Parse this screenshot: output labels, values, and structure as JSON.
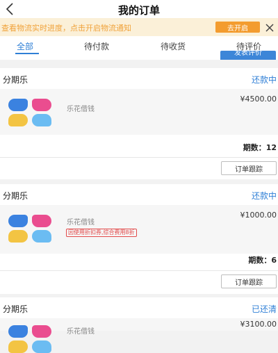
{
  "header": {
    "title": "我的订单"
  },
  "notice": {
    "text": "查看物流实时进度，点击开启物流通知",
    "button_label": "去开启"
  },
  "tabs": [
    {
      "label": "全部",
      "active": true
    },
    {
      "label": "待付款",
      "active": false
    },
    {
      "label": "待收货",
      "active": false
    },
    {
      "label": "待评价",
      "active": false
    }
  ],
  "peek_button_label": "发表评价",
  "orders": [
    {
      "title": "分期乐",
      "status": "还款中",
      "product": "乐花借钱",
      "price": "¥4500.00",
      "periods_label": "期数：",
      "periods_value": "12",
      "track_label": "订单跟踪"
    },
    {
      "title": "分期乐",
      "status": "还款中",
      "product": "乐花借钱",
      "promo": "因使用折扣券,综合费用8折",
      "price": "¥1000.00",
      "periods_label": "期数：",
      "periods_value": "6",
      "track_label": "订单跟踪"
    },
    {
      "title": "分期乐",
      "status": "已还清",
      "product": "乐花借钱",
      "price": "¥3100.00"
    }
  ],
  "colors": {
    "accent": "#2f7fd6",
    "notice_bg": "#fbf0d8",
    "notice_button": "#f39c2f",
    "promo": "#e24a4a"
  }
}
